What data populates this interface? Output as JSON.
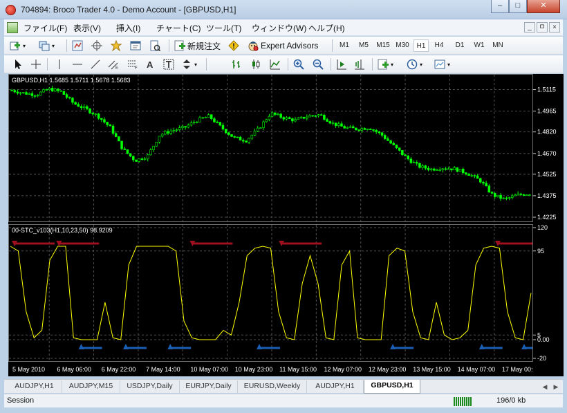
{
  "window": {
    "title": "704894: Broco Trader 4.0 - Demo Account - [GBPUSD,H1]",
    "minimize": "–",
    "maximize": "□",
    "close": "✕"
  },
  "menu": {
    "items": [
      "ファイル(F)",
      "表示(V)",
      "挿入(I)",
      "チャート(C)",
      "ツール(T)",
      "ウィンドウ(W)",
      "ヘルプ(H)"
    ],
    "doc_buttons": [
      "_",
      "ㅁ",
      "×"
    ]
  },
  "toolbar": {
    "new_order_label": "新規注文",
    "expert_advisors_label": "Expert Advisors",
    "timeframes": [
      "M1",
      "M5",
      "M15",
      "M30",
      "H1",
      "H4",
      "D1",
      "W1",
      "MN"
    ],
    "active_timeframe": "H1"
  },
  "drawing_toolbar": {
    "text_tool": "A"
  },
  "chart": {
    "main_label": "GBPUSD,H1  1.5685 1.5711 1.5678 1.5683",
    "indicator_label": "00-STC_v103(H1,10,23,50) 98.9209",
    "background": "#000000",
    "candle_color": "#00ff00",
    "stc_line_color": "#ffff00",
    "sell_signal_color": "#a01020",
    "buy_signal_color": "#1a5fb4",
    "grid_color": "#505050"
  },
  "chart_data": [
    {
      "type": "line",
      "title": "GBPUSD,H1",
      "y_axis_ticks": [
        "1.5115",
        "1.4965",
        "1.4820",
        "1.4670",
        "1.4525",
        "1.4375",
        "1.4225"
      ],
      "ylim": [
        1.4225,
        1.519
      ],
      "x": [
        "5 May 2010",
        "6 May 06:00",
        "6 May 22:00",
        "7 May 14:00",
        "10 May 07:00",
        "10 May 23:00",
        "11 May 15:00",
        "12 May 07:00",
        "12 May 23:00",
        "13 May 15:00",
        "14 May 07:00",
        "17 May 00:00"
      ],
      "series": [
        {
          "values": [
            1.511,
            1.509,
            1.508,
            1.512,
            1.51,
            1.502,
            1.498,
            1.493,
            1.485,
            1.47,
            1.462,
            1.465,
            1.48,
            1.483,
            1.485,
            1.49,
            1.493,
            1.485,
            1.478,
            1.476,
            1.484,
            1.495,
            1.492,
            1.49,
            1.493,
            1.494,
            1.488,
            1.485,
            1.484,
            1.485,
            1.48,
            1.472,
            1.464,
            1.458,
            1.456,
            1.457,
            1.456,
            1.453,
            1.448,
            1.438,
            1.435,
            1.438,
            1.439
          ]
        }
      ]
    },
    {
      "type": "line",
      "title": "00-STC_v103(H1,10,23,50)",
      "y_axis_ticks": [
        "120",
        "95",
        "5",
        "0.00",
        "-20"
      ],
      "ylim": [
        -20,
        120
      ],
      "sell_signals_at": [
        "5 May 2010",
        "6 May 06:00",
        "10 May 07:00",
        "11 May 15:00",
        "17 May 00:00"
      ],
      "buy_signals_at": [
        "6 May 06:00",
        "6 May 22:00",
        "7 May 14:00",
        "10 May 23:00",
        "12 May 23:00",
        "14 May 07:00",
        "17 May 00:00"
      ],
      "series": [
        {
          "values": [
            100,
            95,
            30,
            2,
            10,
            85,
            100,
            100,
            2,
            0,
            0,
            0,
            40,
            2,
            0,
            80,
            100,
            100,
            100,
            100,
            100,
            95,
            20,
            2,
            0,
            0,
            0,
            10,
            5,
            40,
            90,
            98,
            100,
            98,
            30,
            2,
            0,
            60,
            90,
            60,
            2,
            0,
            80,
            95,
            2,
            0,
            0,
            0,
            90,
            98,
            95,
            30,
            2,
            0,
            40,
            5,
            0,
            2,
            10,
            80,
            98,
            100,
            98,
            30,
            2,
            0,
            50
          ]
        }
      ]
    }
  ],
  "tabs": {
    "items": [
      "AUDJPY,H1",
      "AUDJPY,M15",
      "USDJPY,Daily",
      "EURJPY,Daily",
      "EURUSD,Weekly",
      "AUDJPY,H1",
      "GBPUSD,H1"
    ],
    "active": "GBPUSD,H1"
  },
  "status": {
    "left": "Session",
    "traffic": "196/0 kb"
  }
}
